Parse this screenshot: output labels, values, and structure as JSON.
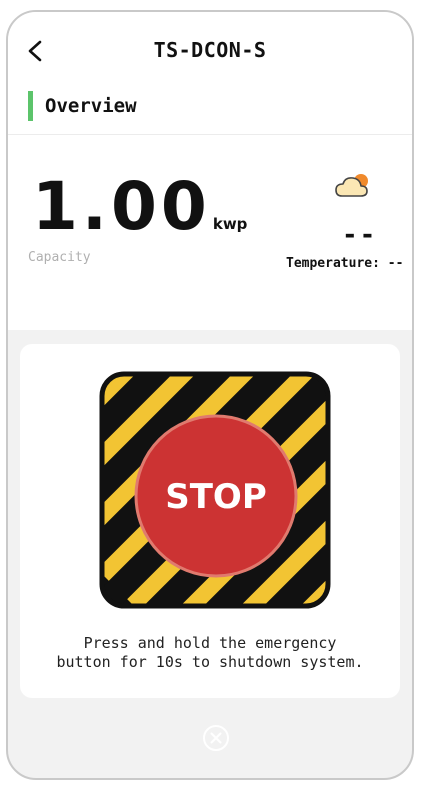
{
  "header": {
    "title": "TS-DCON-S",
    "back_icon": "chevron-left-icon"
  },
  "section": {
    "title": "Overview",
    "accent_color": "#5cc46b"
  },
  "capacity": {
    "value": "1.00",
    "unit": "kwp",
    "label": "Capacity"
  },
  "weather": {
    "icon": "cloud-sun-icon",
    "value": "--",
    "label": "Temperature: --"
  },
  "emergency": {
    "button_label": "STOP",
    "instruction_line1": "Press and hold the emergency",
    "instruction_line2": "button for 10s to shutdown system.",
    "stripe_color": "#f2c433",
    "button_color": "#cc3333"
  },
  "footer": {
    "close_icon": "close-circle-icon"
  }
}
